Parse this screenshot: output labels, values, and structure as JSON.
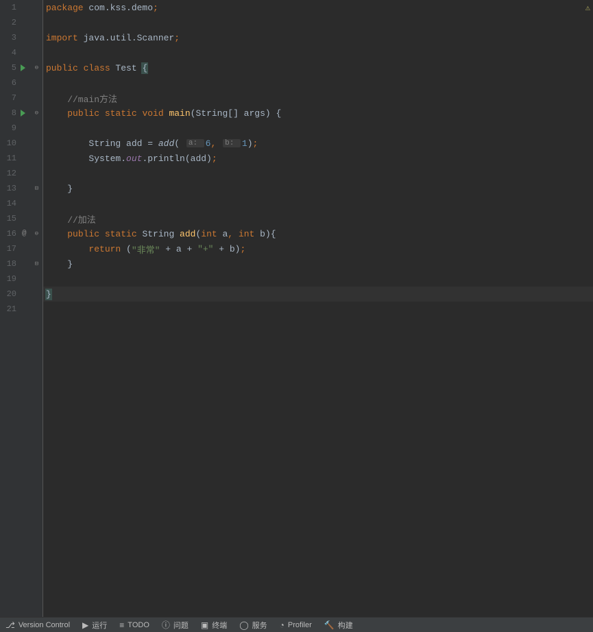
{
  "code": {
    "l1": {
      "pkg": "package ",
      "path": "com.kss.demo",
      "end": ";"
    },
    "l3": {
      "imp": "import ",
      "path": "java.util.Scanner",
      "end": ";"
    },
    "l5": {
      "pub": "public ",
      "cls": "class ",
      "name": "Test ",
      "brace": "{"
    },
    "l7": {
      "comment": "    //main方法"
    },
    "l8": {
      "indent": "    ",
      "pub": "public ",
      "stat": "static ",
      "void": "void ",
      "name": "main",
      "params": "(String[] args) {"
    },
    "l10": {
      "indent": "        ",
      "type": "String add = ",
      "call": "add",
      "p1l": "a: ",
      "p1v": "6",
      "comma": ", ",
      "p2l": "b: ",
      "p2v": "1",
      "end": ");",
      "open": "( "
    },
    "l11": {
      "indent": "        ",
      "sys": "System.",
      "out": "out",
      "call": ".println(add)",
      "end": ";"
    },
    "l13": {
      "indent": "    ",
      "brace": "}"
    },
    "l15": {
      "comment": "    //加法"
    },
    "l16": {
      "indent": "    ",
      "pub": "public ",
      "stat": "static ",
      "type": "String ",
      "name": "add",
      "params": "(",
      "int1": "int ",
      "a": "a",
      "c1": ", ",
      "int2": "int ",
      "b": "b",
      "end": "){"
    },
    "l17": {
      "indent": "        ",
      "ret": "return ",
      "open": "(",
      "s1": "\"非常\"",
      "p1": " + a + ",
      "s2": "\"+\"",
      "p2": " + b)",
      "end": ";"
    },
    "l18": {
      "indent": "    ",
      "brace": "}"
    },
    "l20": {
      "brace": "}"
    }
  },
  "lines": [
    "1",
    "2",
    "3",
    "4",
    "5",
    "6",
    "7",
    "8",
    "9",
    "10",
    "11",
    "12",
    "13",
    "14",
    "15",
    "16",
    "17",
    "18",
    "19",
    "20",
    "21"
  ],
  "bottom": {
    "vcs": "Version Control",
    "run": "运行",
    "todo": "TODO",
    "problems": "问题",
    "terminal": "终端",
    "services": "服务",
    "profiler": "Profiler",
    "build": "构建"
  }
}
